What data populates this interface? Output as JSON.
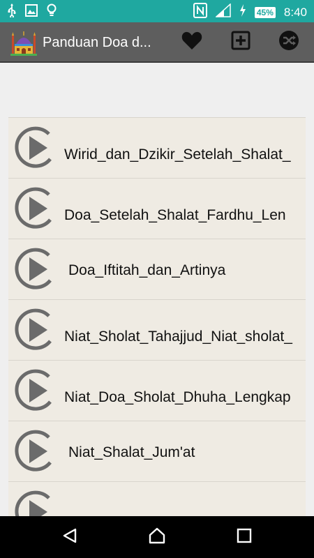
{
  "status_bar": {
    "battery": "45%",
    "time": "8:40",
    "icons": [
      "usb-icon",
      "image-icon",
      "lightbulb-icon",
      "nfc-icon",
      "signal-icon",
      "charging-icon"
    ]
  },
  "action_bar": {
    "title": "Panduan Doa d...",
    "actions": [
      "heart-icon",
      "add-box-icon",
      "shuffle-icon"
    ]
  },
  "list": {
    "items": [
      {
        "label": "Wirid_dan_Dzikir_Setelah_Shalat_Lengkap"
      },
      {
        "label": "Doa_Setelah_Shalat_Fardhu_Lengkap"
      },
      {
        "label": "Doa_Iftitah_dan_Artinya"
      },
      {
        "label": "Niat_Sholat_Tahajjud_Niat_sholat_Sunnah_Malam"
      },
      {
        "label": "Niat_Doa_Sholat_Dhuha_Lengkap"
      },
      {
        "label": "Niat_Shalat_Jum'at"
      },
      {
        "label": ""
      }
    ]
  },
  "colors": {
    "status_bar": "#1fa8a0",
    "action_bar": "#5e5e5e",
    "list_item_bg": "#efebe3",
    "nav_bar": "#000000"
  }
}
